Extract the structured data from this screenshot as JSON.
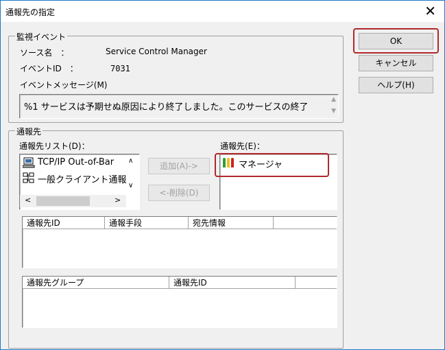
{
  "dialog": {
    "title": "通報先の指定"
  },
  "buttons": {
    "ok": "OK",
    "cancel": "キャンセル",
    "help": "ヘルプ(H)"
  },
  "monitor_event": {
    "group_label": "監視イベント",
    "source_label": "ソース名　：",
    "source_value": "Service Control Manager",
    "event_id_label": "イベントID　：",
    "event_id_value": "7031",
    "message_label": "イベントメッセージ(M)",
    "message_value": "%1 サービスは予期せぬ原因により終了しました。このサービスの終了"
  },
  "destination": {
    "group_label": "通報先",
    "list_label": "通報先リスト(D)：",
    "list_items": [
      {
        "label": "TCP/IP Out-of-Bar",
        "icon": "computer-icon"
      },
      {
        "label": "一般クライアント通報",
        "icon": "network-icon"
      }
    ],
    "add_button": "追加(A)->",
    "remove_button": "<-削除(D)",
    "selected_label": "通報先(E)：",
    "selected_items": [
      {
        "label": "マネージャ",
        "icon": "manager-icon"
      }
    ]
  },
  "table1": {
    "columns": [
      "通報先ID",
      "通報手段",
      "宛先情報"
    ]
  },
  "table2": {
    "columns": [
      "通報先グループ",
      "通報先ID"
    ]
  },
  "colors": {
    "highlight": "#b0272b",
    "window_border": "#1979ca",
    "dialog_bg": "#f0f0f0"
  }
}
